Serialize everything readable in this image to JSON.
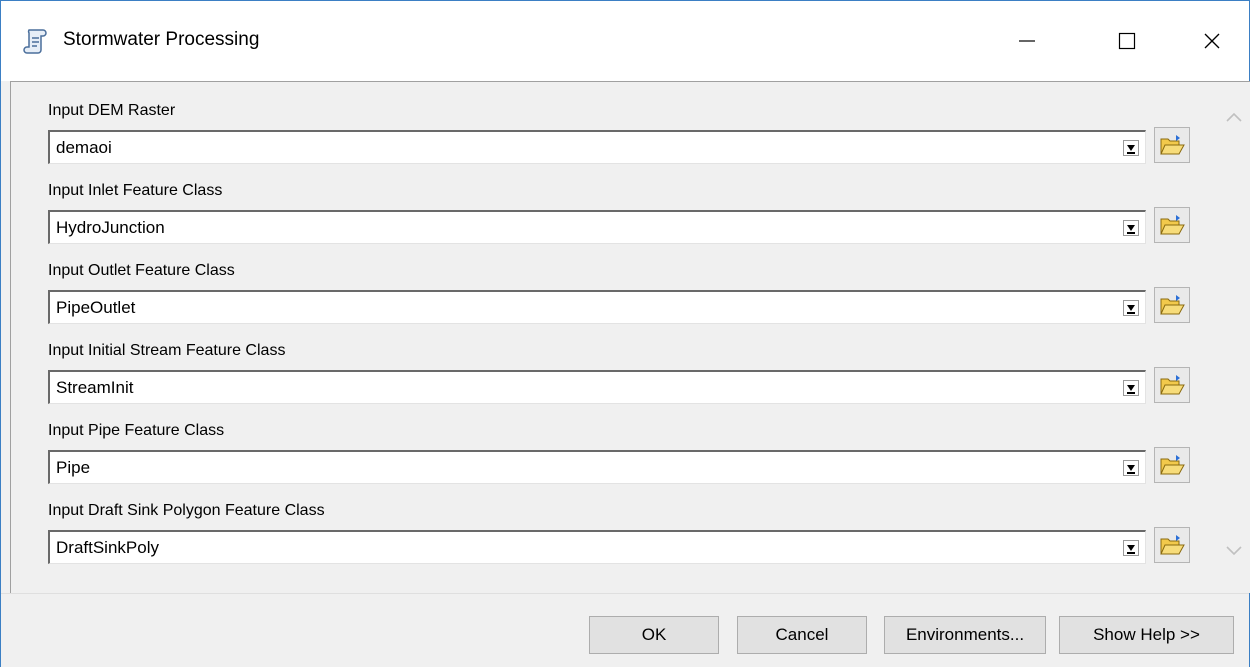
{
  "window": {
    "title": "Stormwater Processing",
    "accent_color": "#3b7fc4"
  },
  "fields": [
    {
      "label": "Input DEM Raster",
      "value": "demaoi"
    },
    {
      "label": "Input Inlet Feature Class",
      "value": "HydroJunction"
    },
    {
      "label": "Input Outlet Feature Class",
      "value": "PipeOutlet"
    },
    {
      "label": "Input Initial Stream Feature Class",
      "value": "StreamInit"
    },
    {
      "label": "Input Pipe Feature Class",
      "value": "Pipe"
    },
    {
      "label": "Input Draft Sink Polygon Feature Class",
      "value": "DraftSinkPoly"
    }
  ],
  "icons": {
    "app": "toolbox-script-icon",
    "browse": "open-folder-icon",
    "minimize": "minimize-icon",
    "maximize": "maximize-icon",
    "close": "close-icon",
    "scroll_up": "chevron-up-icon",
    "scroll_down": "chevron-down-icon"
  },
  "buttons": {
    "ok": "OK",
    "cancel": "Cancel",
    "environments": "Environments...",
    "show_help": "Show Help >>"
  }
}
